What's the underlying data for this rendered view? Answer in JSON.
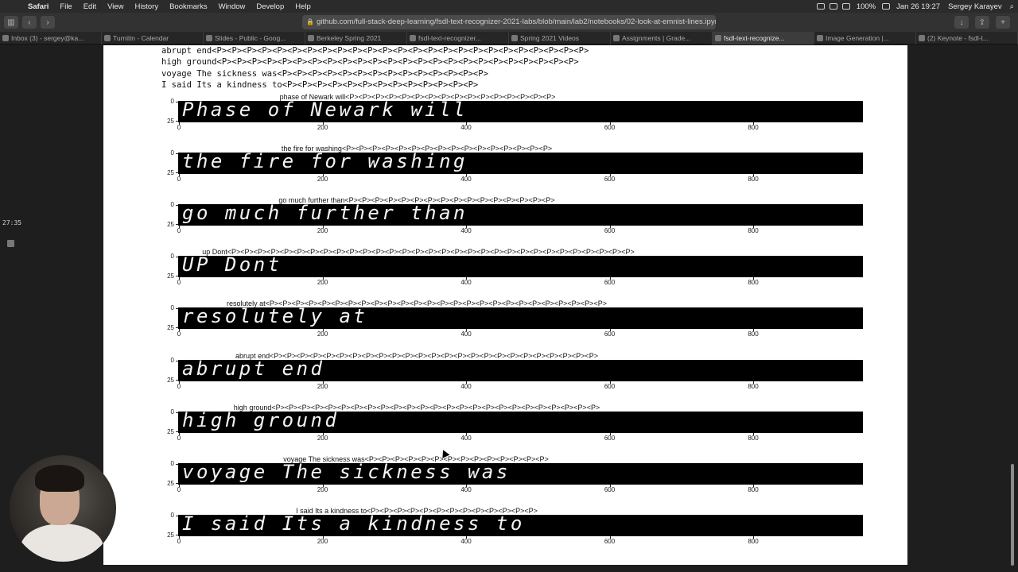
{
  "menubar": {
    "app": "Safari",
    "items": [
      "File",
      "Edit",
      "View",
      "History",
      "Bookmarks",
      "Window",
      "Develop",
      "Help"
    ],
    "battery": "100%",
    "date_time": "Jan 26  19:27",
    "user": "Sergey Karayev"
  },
  "toolbar": {
    "url": "github.com/full-stack-deep-learning/fsdl-text-recognizer-2021-labs/blob/main/lab2/notebooks/02-look-at-emnist-lines.ipynb"
  },
  "tabs": [
    {
      "label": "Inbox (3) - sergey@ka...",
      "active": false
    },
    {
      "label": "Turnitin - Calendar",
      "active": false
    },
    {
      "label": "Slides - Public - Goog...",
      "active": false
    },
    {
      "label": "Berkeley Spring 2021",
      "active": false
    },
    {
      "label": "fsdl-text-recognizer...",
      "active": false
    },
    {
      "label": "Spring 2021 Videos",
      "active": false
    },
    {
      "label": "Assignments | Grade...",
      "active": false
    },
    {
      "label": "fsdl-text-recognize...",
      "active": true
    },
    {
      "label": "Image Generation |...",
      "active": false
    },
    {
      "label": "(2) Keynote - fsdl-t...",
      "active": false
    }
  ],
  "timer": "27:35",
  "notebook": {
    "output_lines": [
      "abrupt end<P><P><P><P><P><P><P><P><P><P><P><P><P><P><P><P><P><P><P><P><P><P><P><P><P>",
      "high ground<P><P><P><P><P><P><P><P><P><P><P><P><P><P><P><P><P><P><P><P><P><P><P><P>",
      "voyage The sickness was<P><P><P><P><P><P><P><P><P><P><P><P><P><P>",
      "I said Its a kindness to<P><P><P><P><P><P><P><P><P><P><P><P><P>"
    ],
    "plots": [
      {
        "title": "phase of Newark will<P><P><P><P><P><P><P><P><P><P><P><P><P><P><P><P>",
        "handwriting": "Phase of Newark will"
      },
      {
        "title": "the fire for washing<P><P><P><P><P><P><P><P><P><P><P><P><P><P><P><P>",
        "handwriting": "the fire for washing"
      },
      {
        "title": "go much further than<P><P><P><P><P><P><P><P><P><P><P><P><P><P><P><P>",
        "handwriting": "go much further than"
      },
      {
        "title": "up Dont<P><P><P><P><P><P><P><P><P><P><P><P><P><P><P><P><P><P><P><P><P><P><P><P><P><P><P><P><P><P><P>",
        "handwriting": "UP Dont"
      },
      {
        "title": "resolutely at<P><P><P><P><P><P><P><P><P><P><P><P><P><P><P><P><P><P><P><P><P><P><P><P><P><P>",
        "handwriting": "resolutely at"
      },
      {
        "title": "abrupt end<P><P><P><P><P><P><P><P><P><P><P><P><P><P><P><P><P><P><P><P><P><P><P><P><P>",
        "handwriting": "abrupt end"
      },
      {
        "title": "high ground<P><P><P><P><P><P><P><P><P><P><P><P><P><P><P><P><P><P><P><P><P><P><P><P><P>",
        "handwriting": "high ground"
      },
      {
        "title": "voyage The sickness was<P><P><P><P><P><P><P><P><P><P><P><P><P><P>",
        "handwriting": "voyage The sickness was"
      },
      {
        "title": "I said Its a kindness to<P><P><P><P><P><P><P><P><P><P><P><P><P>",
        "handwriting": "I said Its a kindness to"
      }
    ],
    "y_ticks": [
      "0",
      "25"
    ],
    "x_ticks": [
      "0",
      "200",
      "400",
      "600",
      "800"
    ]
  }
}
